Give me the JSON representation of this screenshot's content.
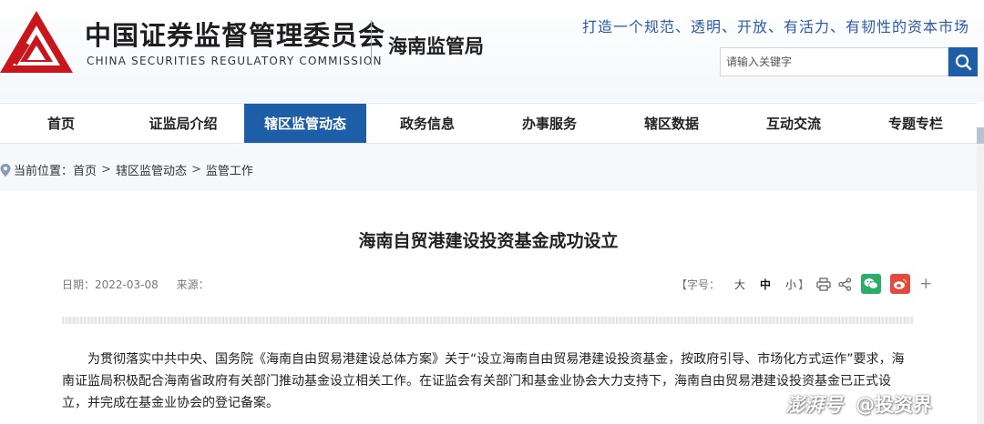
{
  "header": {
    "title_cn": "中国证券监督管理委员会",
    "title_en": "CHINA SECURITIES REGULATORY COMMISSION",
    "bureau": "海南监管局",
    "slogan": "打造一个规范、透明、开放、有活力、有韧性的资本市场",
    "brand_color": "#1e5ea8",
    "logo_color": "#c8161d"
  },
  "search": {
    "placeholder": "请输入关键字",
    "icon": "search-icon"
  },
  "nav": {
    "items": [
      {
        "label": "首页"
      },
      {
        "label": "证监局介绍"
      },
      {
        "label": "辖区监管动态"
      },
      {
        "label": "政务信息"
      },
      {
        "label": "办事服务"
      },
      {
        "label": "辖区数据"
      },
      {
        "label": "互动交流"
      },
      {
        "label": "专题专栏"
      }
    ],
    "active_index": 2
  },
  "breadcrumb": {
    "prefix": "当前位置：",
    "items": [
      "首页",
      "辖区监管动态",
      "监管工作"
    ],
    "separator": ">"
  },
  "article": {
    "title": "海南自贸港建设投资基金成功设立",
    "date_label": "日期：",
    "date": "2022-03-08",
    "source_label": "来源：",
    "font_size_label": "【字号：",
    "font_sizes": [
      "大",
      "中",
      "小"
    ],
    "font_size_close": "】",
    "tools": [
      "print-icon",
      "share-icon",
      "wechat-icon",
      "weibo-icon",
      "plus-icon"
    ],
    "plus": "+",
    "body": "为贯彻落实中共中央、国务院《海南自由贸易港建设总体方案》关于“设立海南自由贸易港建设投资基金，按政府引导、市场化方式运作”要求，海南证监局积极配合海南省政府有关部门推动基金设立相关工作。在证监会有关部门和基金业协会大力支持下，海南自由贸易港建设投资基金已正式设立，并完成在基金业协会的登记备案。"
  },
  "watermark": {
    "brand": "澎湃号",
    "handle": "@投资界"
  }
}
